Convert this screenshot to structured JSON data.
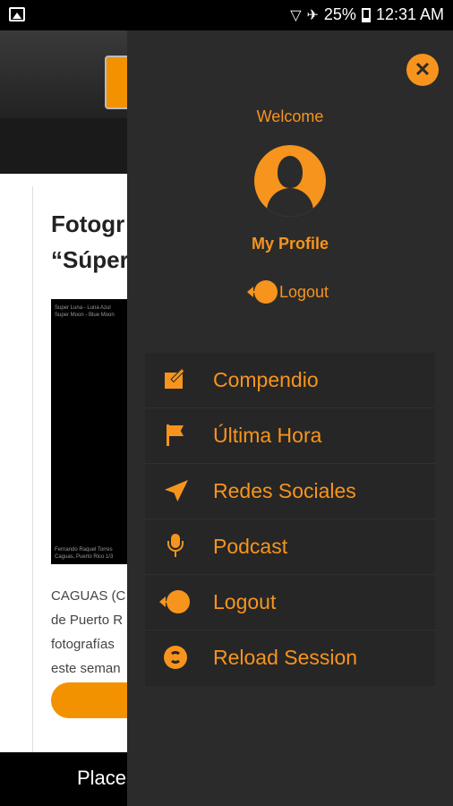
{
  "status_bar": {
    "battery": "25%",
    "time": "12:31 AM"
  },
  "background": {
    "article_title": "Fotogr\n“Súper",
    "image_caption_top": "Super Luna - Luna Azul\nSuper Moon - Blue Moon",
    "image_caption_bottom": "Fernando Raquel Torres\nCaguas, Puerto Rico 1/3",
    "text": "CAGUAS (C\nde Puerto R\nfotografías\neste seman",
    "footer_text": "Place"
  },
  "drawer": {
    "welcome": "Welcome",
    "profile_label": "My Profile",
    "logout_top": "Logout",
    "menu": [
      {
        "label": "Compendio",
        "icon": "edit-icon"
      },
      {
        "label": "Última Hora",
        "icon": "flag-icon"
      },
      {
        "label": "Redes Sociales",
        "icon": "send-icon"
      },
      {
        "label": "Podcast",
        "icon": "microphone-icon"
      },
      {
        "label": "Logout",
        "icon": "logout-icon"
      },
      {
        "label": "Reload Session",
        "icon": "reload-icon"
      }
    ],
    "accent_color": "#f7941d"
  }
}
